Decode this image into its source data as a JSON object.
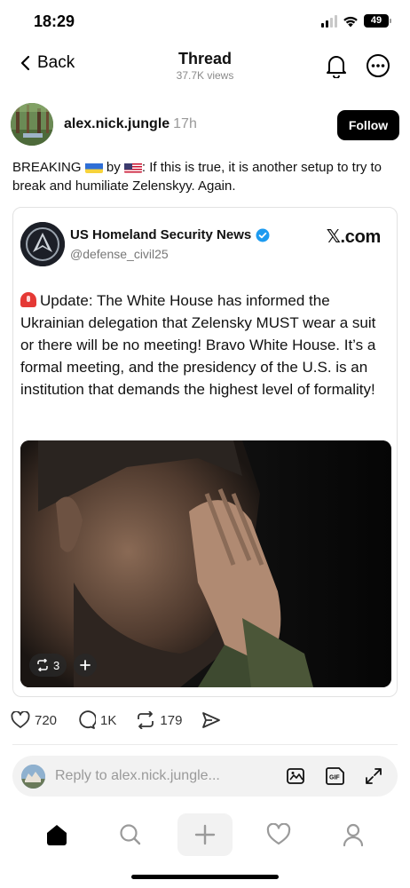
{
  "status_bar": {
    "time": "18:29",
    "battery": "49",
    "icons": [
      "cellular-signal-icon",
      "wifi-icon",
      "battery-icon"
    ]
  },
  "nav": {
    "back_label": "Back",
    "title": "Thread",
    "subtitle": "37.7K views",
    "icons": [
      "chevron-left-icon",
      "bell-icon",
      "more-icon"
    ]
  },
  "post": {
    "username": "alex.nick.jungle",
    "time_ago": "17h",
    "follow_label": "Follow",
    "text_part1": "BREAKING",
    "text_part2": "by",
    "text_part3": ": If this is true, it is another setup to try to break and humiliate Zelenskyy. Again.",
    "flags": [
      "ukraine-flag-icon",
      "us-flag-icon"
    ]
  },
  "embed": {
    "name": "US Homeland Security News",
    "handle": "@defense_civil25",
    "source": "𝕏.com",
    "verified": true,
    "text": "Update: The White House has informed the Ukrainian delegation that Zelensky MUST wear a suit or there will be no meeting! Bravo White House. It’s a formal meeting, and the presidency of the U.S. is an institution that demands the highest level of formality!",
    "photo_repost_count": "3"
  },
  "actions": {
    "likes": "720",
    "comments": "1K",
    "reposts": "179"
  },
  "reply": {
    "placeholder": "Reply to alex.nick.jungle..."
  },
  "tabbar": {
    "tabs": [
      "home-icon",
      "search-icon",
      "plus-icon",
      "heart-icon",
      "profile-icon"
    ]
  },
  "colors": {
    "primary": "#000000",
    "muted": "#8a8a8a",
    "verified": "#1d9bf0",
    "siren": "#e53935"
  }
}
